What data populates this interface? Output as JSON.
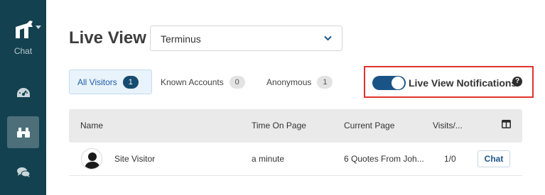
{
  "sidebar": {
    "brand_label": "Chat",
    "items": [
      {
        "icon": "dashboard-gauge-icon"
      },
      {
        "icon": "binoculars-icon",
        "active": true
      },
      {
        "icon": "chat-bubbles-icon"
      }
    ]
  },
  "header": {
    "title": "Live View",
    "account_select": {
      "value": "Terminus"
    }
  },
  "tabs": [
    {
      "label": "All Visitors",
      "count": "1",
      "active": true
    },
    {
      "label": "Known Accounts",
      "count": "0"
    },
    {
      "label": "Anonymous",
      "count": "1"
    }
  ],
  "notifications": {
    "label": "Live View Notifications",
    "enabled": true,
    "help": "?"
  },
  "table": {
    "columns": [
      "Name",
      "Time On Page",
      "Current Page",
      "Visits/..."
    ],
    "rows": [
      {
        "name": "Site Visitor",
        "time_on_page": "a minute",
        "current_page": "6 Quotes From Joh...",
        "visits": "1/0",
        "action": "Chat"
      }
    ]
  },
  "colors": {
    "sidebar": "#13414f",
    "accent": "#1a5487",
    "highlight_border": "#e0342f"
  }
}
